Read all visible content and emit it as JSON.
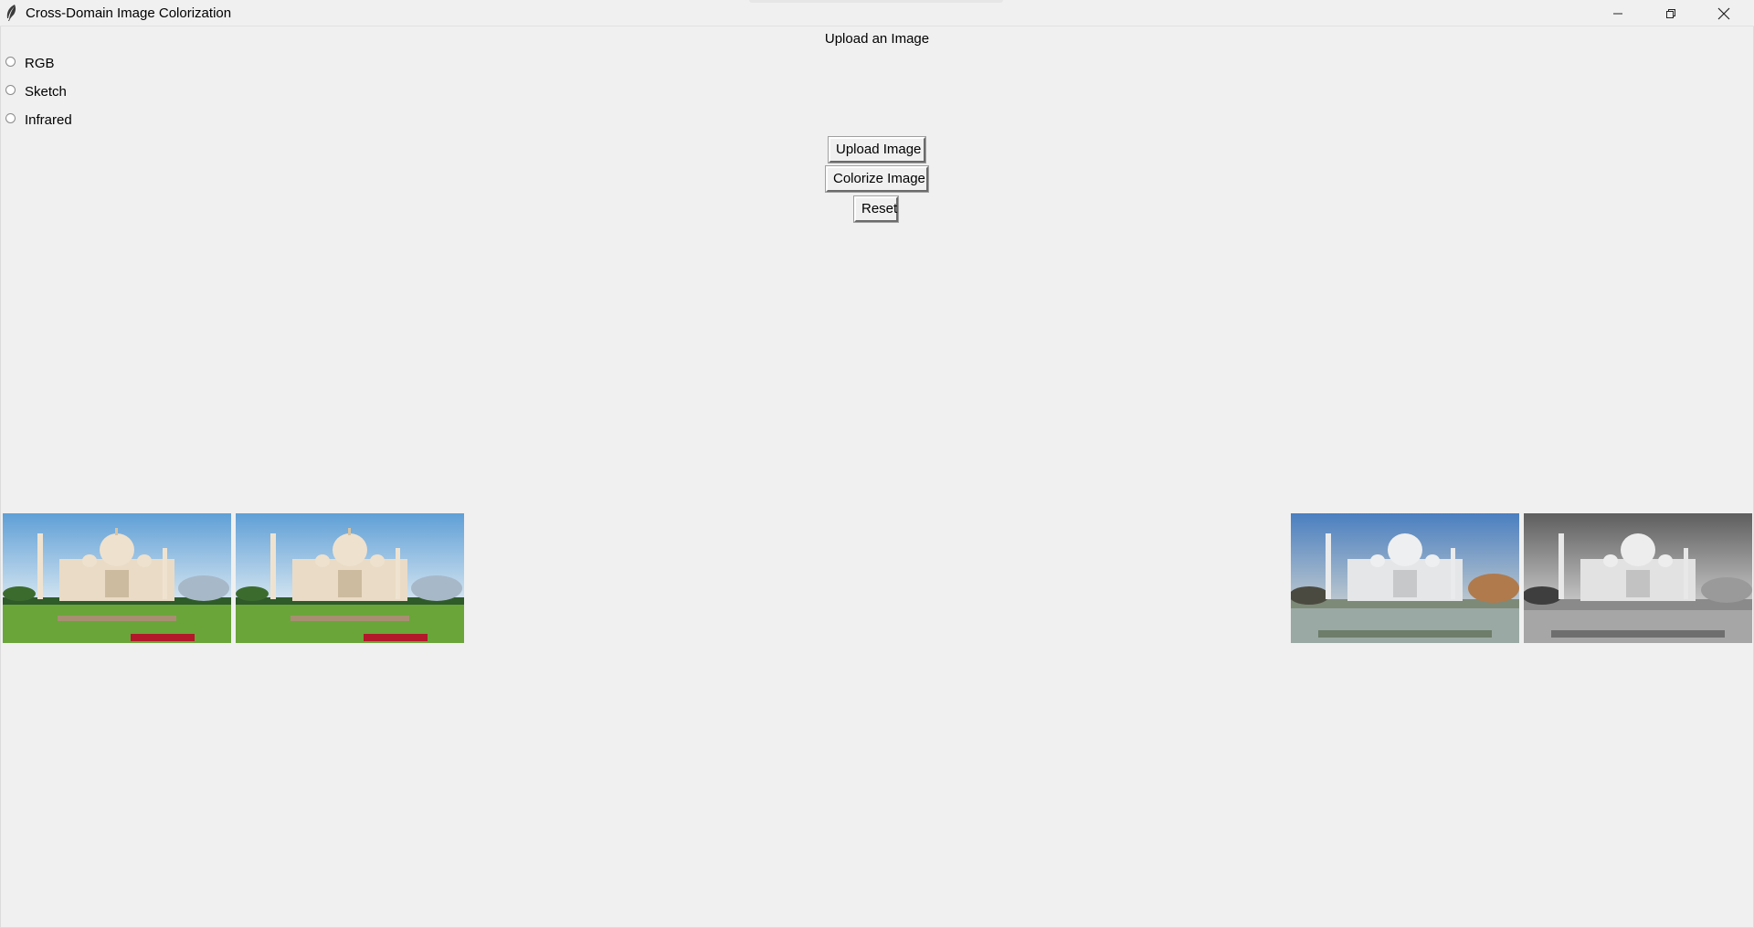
{
  "window": {
    "title": "Cross-Domain Image Colorization",
    "icon": "feather-icon",
    "controls": [
      "minimize-icon",
      "restore-icon",
      "close-icon"
    ]
  },
  "main": {
    "heading": "Upload an Image",
    "domain_options": [
      {
        "label": "RGB",
        "selected": false
      },
      {
        "label": "Sketch",
        "selected": false
      },
      {
        "label": "Infrared",
        "selected": false
      }
    ],
    "buttons": {
      "upload": "Upload Image",
      "colorize": "Colorize Image",
      "reset": "Reset"
    },
    "images": [
      {
        "name": "input-image-color",
        "style": "color"
      },
      {
        "name": "input-image-color-copy",
        "style": "color"
      },
      {
        "name": "colorized-output-image",
        "style": "colorized"
      },
      {
        "name": "grayscale-image",
        "style": "grayscale"
      }
    ]
  },
  "colors": {
    "background": "#f0f0f0",
    "sky_color": "#6fa8d8",
    "grass_color": "#6aa53a",
    "marble": "#eadbc6"
  }
}
